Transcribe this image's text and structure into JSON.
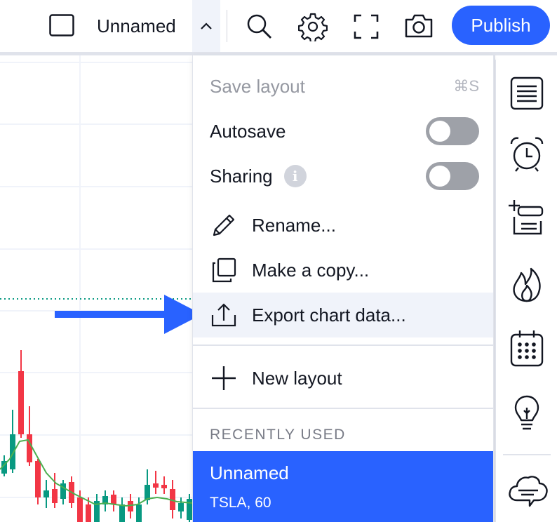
{
  "header": {
    "layout_name": "Unnamed",
    "publish_label": "Publish"
  },
  "menu": {
    "save_layout": "Save layout",
    "save_shortcut": "⌘S",
    "autosave": "Autosave",
    "sharing": "Sharing",
    "info_glyph": "i",
    "rename": "Rename...",
    "make_copy": "Make a copy...",
    "export": "Export chart data...",
    "new_layout": "New layout",
    "recent_header": "RECENTLY USED",
    "recent_item": {
      "name": "Unnamed",
      "symbol": "TSLA, 60"
    },
    "toggles": {
      "autosave_on": false,
      "sharing_on": false
    }
  },
  "right_toolbar": {
    "icons": [
      "watchlist-icon",
      "alarm-clock-icon",
      "add-note-icon",
      "fire-icon",
      "calendar-icon",
      "lightbulb-icon",
      "chat-cloud-icon"
    ]
  },
  "colors": {
    "accent": "#2962ff",
    "up": "#089981",
    "down": "#f23645",
    "ma_line": "#4caf50",
    "arrow": "#2962ff"
  }
}
